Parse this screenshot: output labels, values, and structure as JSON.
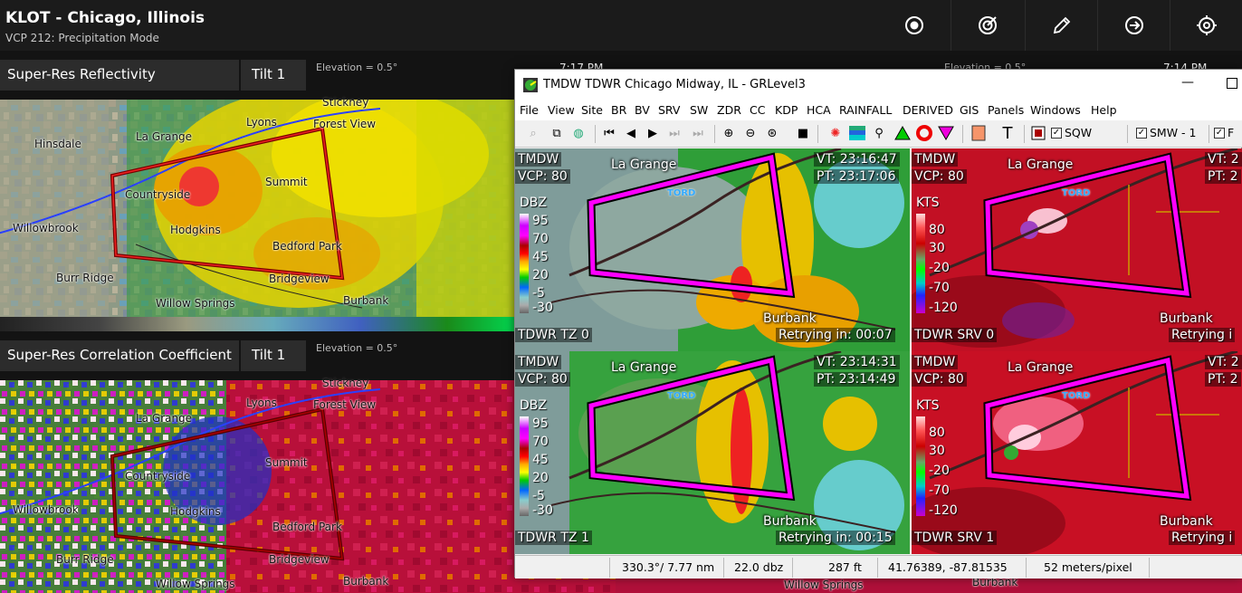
{
  "app": {
    "title": "KLOT - Chicago, Illinois",
    "subtitle": "VCP 212: Precipitation Mode",
    "toolbar_icons": [
      "record-icon",
      "radar-target-icon",
      "pencil-icon",
      "exit-icon",
      "crosshair-icon"
    ]
  },
  "panels": [
    {
      "product": "Super-Res Reflectivity",
      "tilt": "Tilt 1",
      "elevation": "Elevation = 0.5°",
      "time": "7:17 PM",
      "elevation_right": "Elevation = 0.5°",
      "time_right": "7:14 PM"
    },
    {
      "product": "Super-Res Correlation Coefficient",
      "tilt": "Tilt 1",
      "elevation": "Elevation = 0.5°"
    }
  ],
  "map_labels": [
    "Stickney",
    "Lyons",
    "Forest View",
    "Hinsdale",
    "La Grange",
    "Countryside",
    "Summit",
    "Willowbrook",
    "Hodgkins",
    "Bedford Park",
    "Burr Ridge",
    "Bridgeview",
    "Willow Springs",
    "Burbank"
  ],
  "grlevel": {
    "title": "TMDW TDWR Chicago Midway, IL - GRLevel3",
    "menu": [
      "File",
      "View",
      "Site",
      "BR",
      "BV",
      "SRV",
      "SW",
      "ZDR",
      "CC",
      "KDP",
      "HCA",
      "RAINFALL",
      "DERIVED",
      "GIS",
      "Panels",
      "Windows",
      "Help"
    ],
    "toolbar_checks": [
      {
        "label": "SQW",
        "checked": true
      },
      {
        "label": "SMW - 1",
        "checked": true
      },
      {
        "label": "F",
        "checked": true
      }
    ],
    "panes": [
      {
        "site": "TMDW",
        "vcp": "VCP: 80",
        "vt": "VT: 23:16:47",
        "pt": "PT: 23:17:06",
        "unit": "DBZ",
        "ticks": [
          "95",
          "70",
          "45",
          "20",
          "-5",
          "-30"
        ],
        "name": "TDWR TZ 0",
        "retry": "Retrying in: 00:07",
        "place_top": "La Grange",
        "place_bottom": "Burbank",
        "marker": "TORD"
      },
      {
        "site": "TMDW",
        "vcp": "VCP: 80",
        "vt": "VT: 2",
        "pt": "PT: 2",
        "unit": "KTS",
        "ticks": [
          "80",
          "30",
          "-20",
          "-70",
          "-120"
        ],
        "name": "TDWR SRV 0",
        "retry": "Retrying i",
        "place_top": "La Grange",
        "place_bottom": "Burbank",
        "marker": "TORD"
      },
      {
        "site": "TMDW",
        "vcp": "VCP: 80",
        "vt": "VT: 23:14:31",
        "pt": "PT: 23:14:49",
        "unit": "DBZ",
        "ticks": [
          "95",
          "70",
          "45",
          "20",
          "-5",
          "-30"
        ],
        "name": "TDWR TZ 1",
        "retry": "Retrying in: 00:15",
        "place_top": "La Grange",
        "place_bottom": "Burbank",
        "marker": "TORD"
      },
      {
        "site": "TMDW",
        "vcp": "VCP: 80",
        "vt": "VT: 2",
        "pt": "PT: 2",
        "unit": "KTS",
        "ticks": [
          "80",
          "30",
          "-20",
          "-70",
          "-120"
        ],
        "name": "TDWR SRV 1",
        "retry": "Retrying i",
        "place_top": "La Grange",
        "place_bottom": "Burbank",
        "marker": "TORD"
      }
    ],
    "status": {
      "azimuth": "330.3°/ 7.77 nm",
      "value": "22.0 dbz",
      "height": "287 ft",
      "coords": "41.76389, -87.81535",
      "scale": "52 meters/pixel"
    }
  },
  "bottom_right_labels": [
    "Willow Springs",
    "Burbank"
  ],
  "colors": {
    "warning_polygon": "#ff00ff",
    "storm_polygon": "#cc0000",
    "appbar": "#1b1b1b"
  }
}
